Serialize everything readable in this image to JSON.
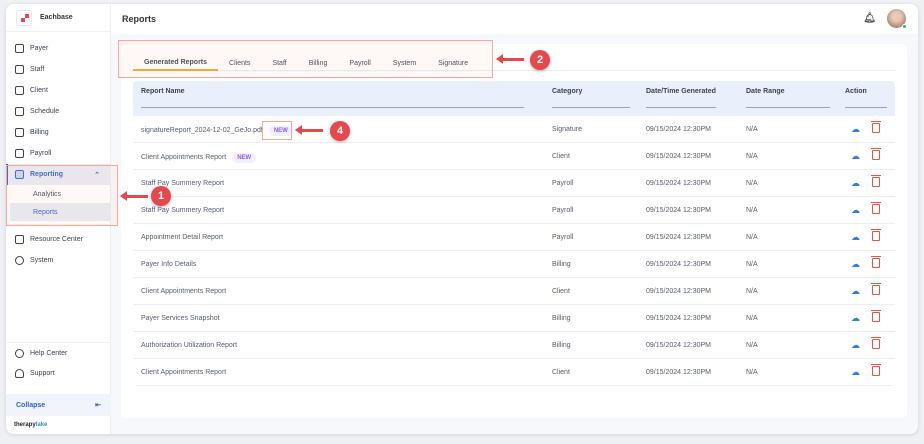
{
  "brand": "Eachbase",
  "sidebar": {
    "items": [
      {
        "label": "Payer",
        "icon": "shield-icon"
      },
      {
        "label": "Staff",
        "icon": "staff-icon"
      },
      {
        "label": "Client",
        "icon": "client-icon"
      },
      {
        "label": "Schedule",
        "icon": "calendar-icon"
      },
      {
        "label": "Billing",
        "icon": "billing-icon"
      },
      {
        "label": "Payroll",
        "icon": "payroll-icon"
      }
    ],
    "reporting": "Reporting",
    "sub": [
      "Analytics",
      "Reports"
    ],
    "after": [
      {
        "label": "Resource Center",
        "icon": "folder-icon"
      },
      {
        "label": "System",
        "icon": "gear-icon"
      }
    ],
    "help": "Help Center",
    "support": "Support",
    "collapse": "Collapse",
    "footer_a": "therapy",
    "footer_b": "lake"
  },
  "header": {
    "title": "Reports"
  },
  "tabs": [
    "Generated Reports",
    "Clients",
    "Staff",
    "Billing",
    "Payroll",
    "System",
    "Signature"
  ],
  "table": {
    "headers": [
      "Report Name",
      "Category",
      "Date/Time Generated",
      "Date Range",
      "Action"
    ],
    "new_label": "NEW",
    "rows": [
      {
        "name": "signatureReport_2024-12-02_GeJo.pdf",
        "new": true,
        "category": "Signature",
        "date": "09/15/2024 12:30PM",
        "range": "N/A"
      },
      {
        "name": "Client Appointments Report",
        "new": true,
        "category": "Client",
        "date": "09/15/2024 12:30PM",
        "range": "N/A"
      },
      {
        "name": "Staff Pay Summery Report",
        "category": "Payroll",
        "date": "09/15/2024 12:30PM",
        "range": "N/A"
      },
      {
        "name": "Staff Pay Summery Report",
        "category": "Payroll",
        "date": "09/15/2024 12:30PM",
        "range": "N/A"
      },
      {
        "name": "Appointment Detail Report",
        "category": "Payroll",
        "date": "09/15/2024 12:30PM",
        "range": "N/A"
      },
      {
        "name": "Payer Info Details",
        "category": "Billing",
        "date": "09/15/2024 12:30PM",
        "range": "N/A"
      },
      {
        "name": "Client Appointments Report",
        "category": "Client",
        "date": "09/15/2024 12:30PM",
        "range": "N/A"
      },
      {
        "name": "Payer Services Snapshot",
        "category": "Billing",
        "date": "09/15/2024 12:30PM",
        "range": "N/A"
      },
      {
        "name": "Authorization Utilization Report",
        "category": "Billing",
        "date": "09/15/2024 12:30PM",
        "range": "N/A"
      },
      {
        "name": "Client Appointments Report",
        "category": "Client",
        "date": "09/15/2024 12:30PM",
        "range": "N/A"
      }
    ]
  },
  "annotations": [
    "1",
    "2",
    "4"
  ]
}
